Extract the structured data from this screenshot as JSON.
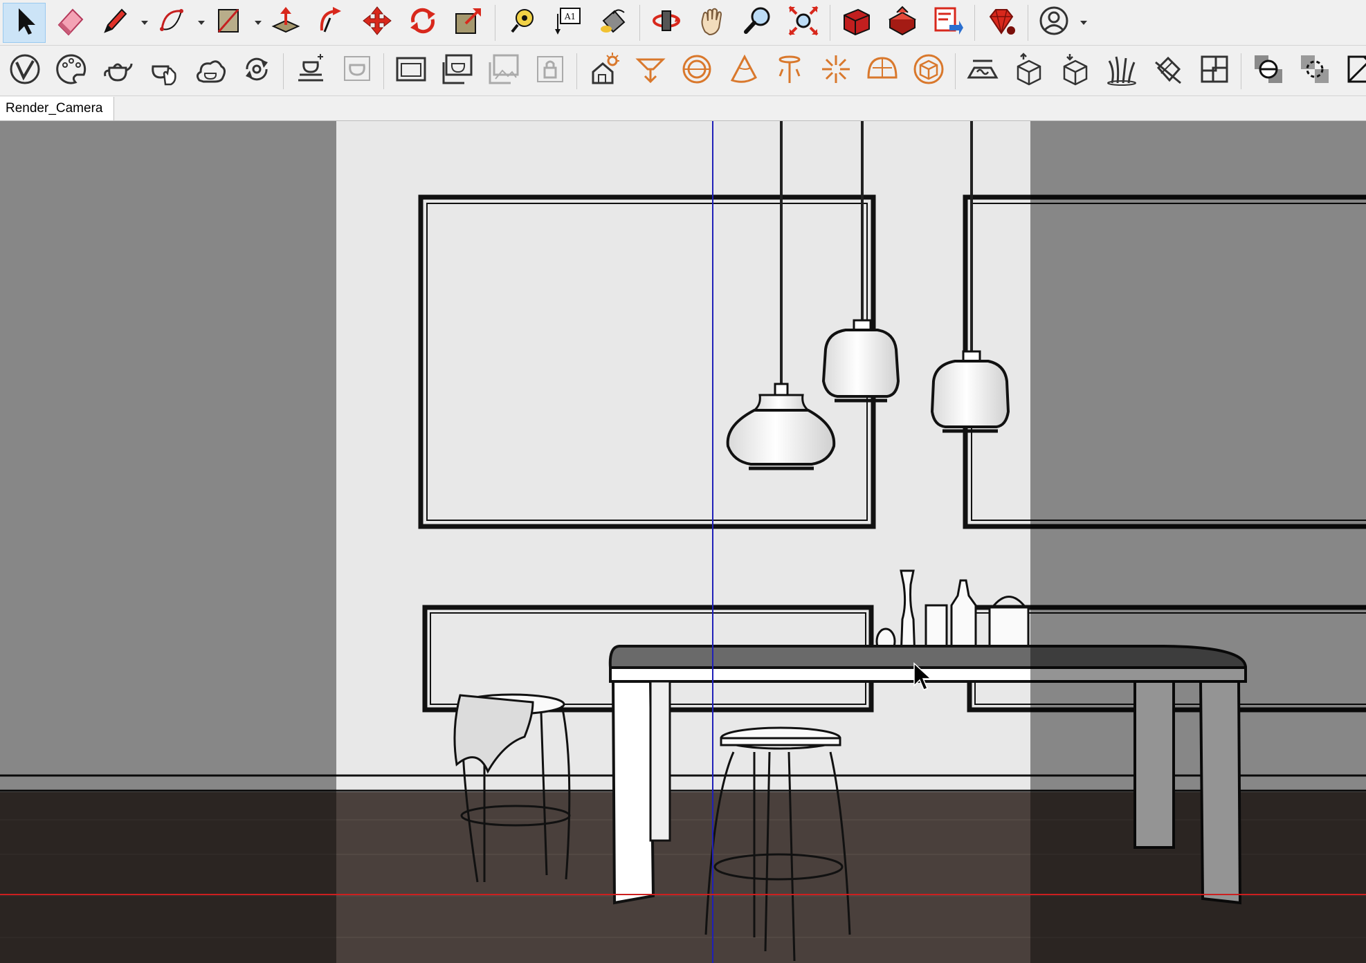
{
  "toolbar_main": {
    "items": [
      {
        "name": "select-tool",
        "icon": "arrow-cursor-icon",
        "active": true
      },
      {
        "name": "eraser-tool",
        "icon": "eraser-icon"
      },
      {
        "name": "line-tool",
        "icon": "pencil-icon",
        "dropdown": true
      },
      {
        "name": "arc-tool",
        "icon": "arc-icon",
        "dropdown": true
      },
      {
        "name": "rectangle-tool",
        "icon": "rectangle-icon",
        "dropdown": true
      },
      {
        "name": "push-pull-tool",
        "icon": "push-pull-icon"
      },
      {
        "name": "follow-me-tool",
        "icon": "follow-me-icon"
      },
      {
        "name": "move-tool",
        "icon": "move-icon"
      },
      {
        "name": "rotate-tool",
        "icon": "rotate-icon"
      },
      {
        "name": "scale-tool",
        "icon": "scale-icon"
      },
      {
        "name": "tape-measure-tool",
        "icon": "tape-measure-icon"
      },
      {
        "name": "text-tool",
        "icon": "text-label-icon",
        "label": "A1"
      },
      {
        "name": "paint-bucket-tool",
        "icon": "paint-bucket-icon"
      },
      {
        "name": "orbit-tool",
        "icon": "orbit-icon"
      },
      {
        "name": "pan-tool",
        "icon": "hand-icon"
      },
      {
        "name": "zoom-tool",
        "icon": "magnifier-icon"
      },
      {
        "name": "zoom-extents-tool",
        "icon": "zoom-extents-icon"
      },
      {
        "name": "3d-warehouse",
        "icon": "warehouse-icon"
      },
      {
        "name": "extension-warehouse",
        "icon": "extension-warehouse-icon"
      },
      {
        "name": "send-to-layout",
        "icon": "layout-icon"
      },
      {
        "name": "ruby-console",
        "icon": "ruby-icon"
      },
      {
        "name": "account",
        "icon": "user-icon",
        "dropdown": true
      }
    ]
  },
  "toolbar_vray": {
    "items": [
      {
        "name": "vray-logo",
        "icon": "vray-logo-icon"
      },
      {
        "name": "asset-editor",
        "icon": "palette-icon"
      },
      {
        "name": "render",
        "icon": "teapot-icon"
      },
      {
        "name": "render-interactive",
        "icon": "teapot-hand-icon"
      },
      {
        "name": "render-cloud",
        "icon": "teapot-cloud-icon"
      },
      {
        "name": "batch-render",
        "icon": "cycle-icon"
      },
      {
        "name": "render-region",
        "icon": "teapot-region-icon"
      },
      {
        "name": "render-region-off",
        "icon": "teapot-region-disabled-icon"
      },
      {
        "name": "frame-buffer",
        "icon": "frame-buffer-icon"
      },
      {
        "name": "frame-buffer-teapot",
        "icon": "frame-teapot-icon"
      },
      {
        "name": "frame-images",
        "icon": "frame-images-icon"
      },
      {
        "name": "lock-camera",
        "icon": "lock-icon"
      },
      {
        "name": "sun-light",
        "icon": "house-sun-icon"
      },
      {
        "name": "spot-light",
        "icon": "spot-light-icon"
      },
      {
        "name": "sphere-light",
        "icon": "sphere-light-icon"
      },
      {
        "name": "cone-light",
        "icon": "cone-light-icon"
      },
      {
        "name": "ies-light",
        "icon": "ies-light-icon"
      },
      {
        "name": "omni-light",
        "icon": "omni-light-icon"
      },
      {
        "name": "dome-light",
        "icon": "dome-light-icon"
      },
      {
        "name": "mesh-light",
        "icon": "mesh-light-icon"
      },
      {
        "name": "infinite-plane",
        "icon": "infinite-plane-icon"
      },
      {
        "name": "export-proxy",
        "icon": "export-box-icon"
      },
      {
        "name": "import-proxy",
        "icon": "import-box-icon"
      },
      {
        "name": "fur",
        "icon": "fur-icon"
      },
      {
        "name": "clipper",
        "icon": "clipper-icon"
      },
      {
        "name": "decal",
        "icon": "decal-icon"
      },
      {
        "name": "section-cut",
        "icon": "section-icon"
      },
      {
        "name": "section-planes",
        "icon": "section-plane-icon"
      },
      {
        "name": "section-display",
        "icon": "section-display-icon"
      }
    ]
  },
  "scenes": {
    "active": "Render_Camera"
  },
  "colors": {
    "toolbar_bg": "#f0f0f0",
    "wall": "#e8e8e8",
    "outside_shade": "#7a7a7a",
    "floor": "#4a403c",
    "blue_axis": "#1f1fb8",
    "red_axis": "#cc1f1f",
    "accent_red": "#d8281c",
    "orange": "#d9782c"
  }
}
